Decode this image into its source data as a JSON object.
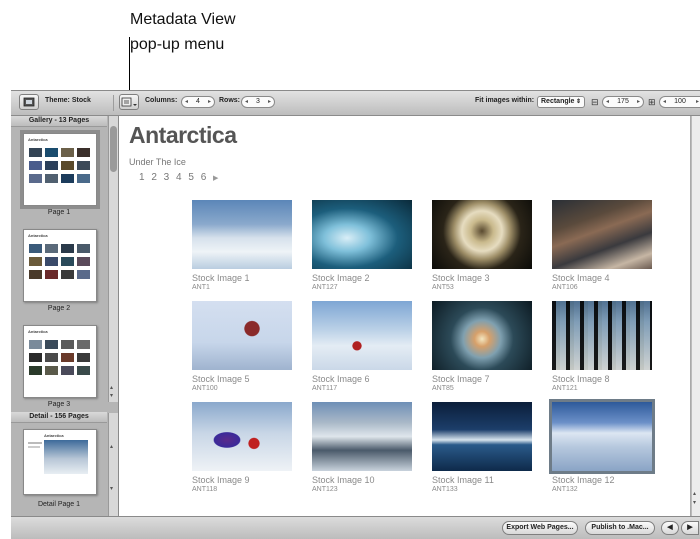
{
  "callout": {
    "line1": "Metadata View",
    "line2": "pop-up menu"
  },
  "toolbar": {
    "theme_label": "Theme: Stock",
    "columns_label": "Columns:",
    "columns_value": "4",
    "rows_label": "Rows:",
    "rows_value": "3",
    "fit_label": "Fit images within:",
    "fit_value": "Rectangle",
    "width_value": "175",
    "height_value": "100"
  },
  "sidebar": {
    "gallery_header": "Gallery - 13 Pages",
    "detail_header": "Detail - 156 Pages",
    "pages": [
      {
        "label": "Page 1",
        "title": "Antarctica"
      },
      {
        "label": "Page 2",
        "title": "Antarctica"
      },
      {
        "label": "Page 3",
        "title": "Antarctica"
      }
    ],
    "detail_page": {
      "label": "Detail Page 1",
      "title": "Antarctica"
    }
  },
  "main": {
    "title": "Antarctica",
    "subtitle": "Under The Ice",
    "page_numbers": "1 2 3 4 5 6",
    "next_icon": "triangle-right-icon",
    "images": [
      {
        "caption": "Stock Image 1",
        "code": "ANT1"
      },
      {
        "caption": "Stock Image 2",
        "code": "ANT127"
      },
      {
        "caption": "Stock Image 3",
        "code": "ANT53"
      },
      {
        "caption": "Stock Image 4",
        "code": "ANT106"
      },
      {
        "caption": "Stock Image 5",
        "code": "ANT100"
      },
      {
        "caption": "Stock Image 6",
        "code": "ANT117"
      },
      {
        "caption": "Stock Image 7",
        "code": "ANT85"
      },
      {
        "caption": "Stock Image 8",
        "code": "ANT121"
      },
      {
        "caption": "Stock Image 9",
        "code": "ANT118"
      },
      {
        "caption": "Stock Image 10",
        "code": "ANT123"
      },
      {
        "caption": "Stock Image 11",
        "code": "ANT133"
      },
      {
        "caption": "Stock Image 12",
        "code": "ANT132"
      }
    ]
  },
  "bottombar": {
    "export_label": "Export Web Pages...",
    "publish_label": "Publish to .Mac..."
  }
}
